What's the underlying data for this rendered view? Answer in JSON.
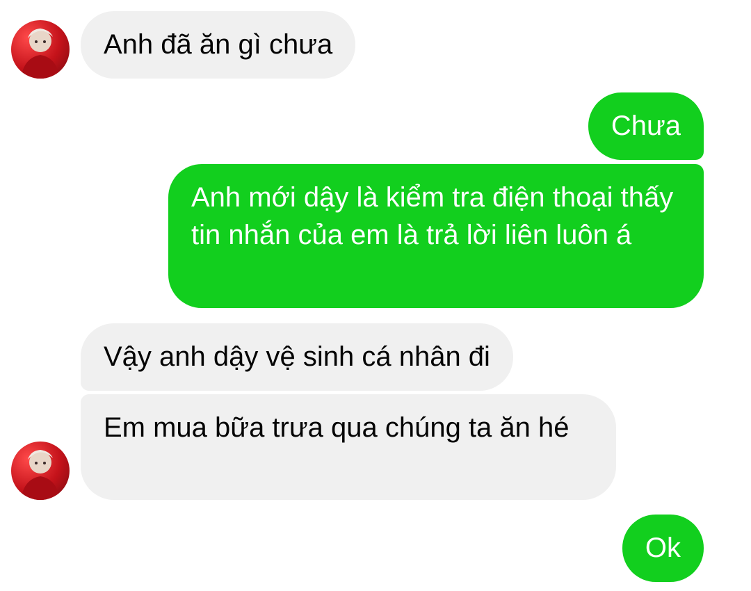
{
  "conversation": {
    "messages": [
      {
        "sender": "contact",
        "text": "Anh đã ăn gì chưa"
      },
      {
        "sender": "me",
        "text": "Chưa"
      },
      {
        "sender": "me",
        "text": "Anh mới dậy là kiểm tra điện thoại thấy tin nhắn của em là trả lời liên luôn á"
      },
      {
        "sender": "contact",
        "text": "Vậy anh dậy vệ sinh cá nhân đi"
      },
      {
        "sender": "contact",
        "text": "Em mua bữa trưa qua chúng ta ăn hé"
      },
      {
        "sender": "me",
        "text": "Ok"
      }
    ]
  },
  "colors": {
    "outgoing_bubble": "#12cf1e",
    "incoming_bubble": "#f0f0f0",
    "avatar_accent": "#c4121a"
  },
  "icons": {
    "avatar": "contact-avatar-photo"
  }
}
